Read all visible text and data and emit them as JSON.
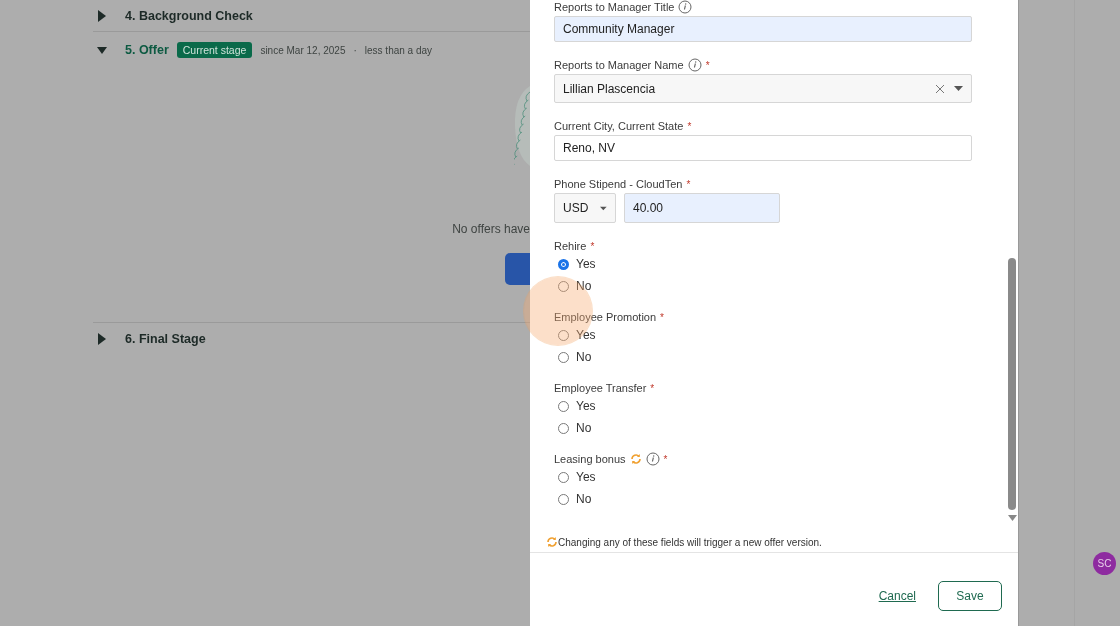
{
  "stages": [
    {
      "title": "4. Background Check",
      "expanded": false
    },
    {
      "title": "5. Offer",
      "expanded": true,
      "badge": "Current stage",
      "since": "since Mar 12, 2025",
      "separator": "·",
      "duration": "less than a day",
      "empty_message": "No offers have"
    },
    {
      "title": "6. Final Stage",
      "expanded": false
    }
  ],
  "form": {
    "fields": [
      {
        "kind": "text",
        "label": "Reports to Manager Title",
        "info": true,
        "value": "Community Manager",
        "highlighted": true
      },
      {
        "kind": "select",
        "label": "Reports to Manager Name",
        "info": true,
        "required_mark": "*",
        "value": "Lillian Plascencia",
        "clearable": true
      },
      {
        "kind": "text",
        "label": "Current City, Current State",
        "required_mark": "*",
        "value": "Reno, NV",
        "highlighted": false
      },
      {
        "kind": "money",
        "label": "Phone Stipend - CloudTen",
        "required_mark": "*",
        "currency": "USD",
        "value": "40.00",
        "highlighted": true
      },
      {
        "kind": "radio",
        "label": "Rehire",
        "required_mark": "*",
        "options": [
          {
            "label": "Yes",
            "selected": true
          },
          {
            "label": "No",
            "selected": false
          }
        ]
      },
      {
        "kind": "radio",
        "label": "Employee Promotion",
        "required_mark": "*",
        "options": [
          {
            "label": "Yes",
            "selected": false
          },
          {
            "label": "No",
            "selected": false
          }
        ]
      },
      {
        "kind": "radio",
        "label": "Employee Transfer",
        "required_mark": "*",
        "options": [
          {
            "label": "Yes",
            "selected": false
          },
          {
            "label": "No",
            "selected": false
          }
        ]
      },
      {
        "kind": "radio",
        "label": "Leasing bonus",
        "sync": true,
        "info": true,
        "required_mark": "*",
        "options": [
          {
            "label": "Yes",
            "selected": false
          },
          {
            "label": "No",
            "selected": false
          }
        ]
      }
    ],
    "note": "Changing any of these fields will trigger a new offer version.",
    "cancel": "Cancel",
    "save": "Save"
  },
  "avatar": {
    "initials": "SC",
    "color": "#8e2ba0"
  }
}
